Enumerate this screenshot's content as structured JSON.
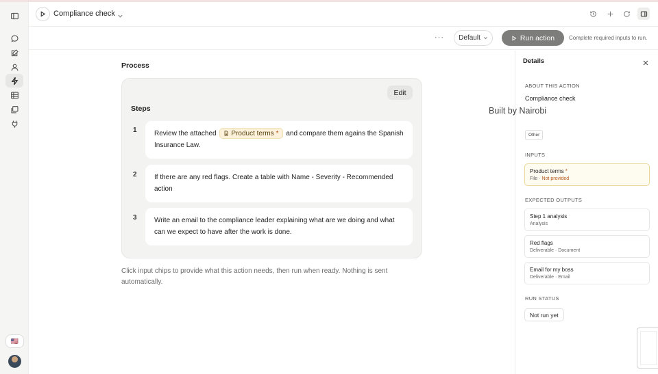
{
  "header": {
    "title": "Compliance check"
  },
  "toolbar": {
    "more_label": "···",
    "preset": "Default",
    "run_label": "Run action",
    "run_hint": "Complete required inputs to run."
  },
  "main": {
    "section_title": "Process",
    "edit_label": "Edit",
    "steps_title": "Steps",
    "steps": [
      {
        "number": "1",
        "before": "Review the attached",
        "chip_label": "Product terms",
        "chip_required": "*",
        "after": "and compare them agains the Spanish Insurance Law."
      },
      {
        "number": "2",
        "text": "If there are any red flags. Create a table with Name - Severity - Recommended action"
      },
      {
        "number": "3",
        "text": "Write an email to the compliance leader explaining what are we doing and what can we expect to have after the work is done."
      }
    ],
    "footnote": "Click input chips to provide what this action needs, then run when ready. Nothing is sent automatically."
  },
  "panel": {
    "title": "Details",
    "about_label": "ABOUT THIS ACTION",
    "about_name": "Compliance check",
    "built_by": "Built by Nairobi",
    "category": "Other",
    "inputs_label": "INPUTS",
    "input": {
      "name": "Product terms",
      "required": "*",
      "type": "File",
      "separator": " · ",
      "status": "Not provided"
    },
    "outputs_label": "EXPECTED OUTPUTS",
    "outputs": [
      {
        "name": "Step 1 analysis",
        "sub": "Analysis"
      },
      {
        "name": "Red flags",
        "sub": "Deliverable · Document"
      },
      {
        "name": "Email for my boss",
        "sub": "Deliverable · Email"
      }
    ],
    "status_label": "RUN STATUS",
    "status": "Not run yet"
  },
  "sidebar": {
    "flag": "🇺🇸"
  }
}
